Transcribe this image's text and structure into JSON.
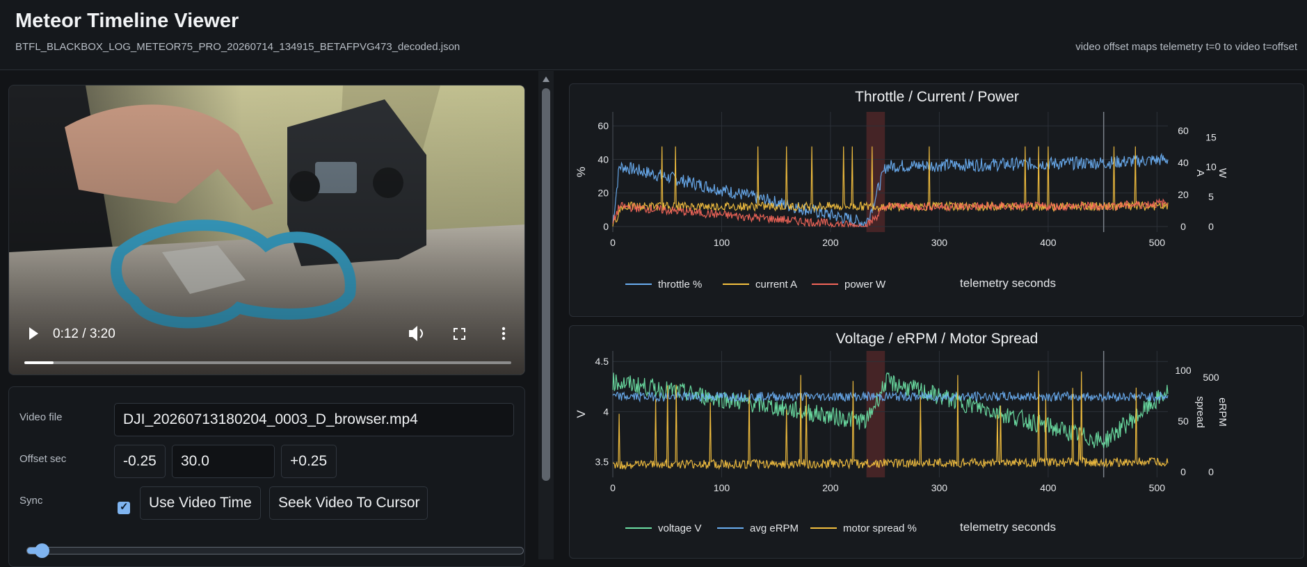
{
  "app": {
    "title": "Meteor Timeline Viewer",
    "file": "BTFL_BLACKBOX_LOG_METEOR75_PRO_20260714_134915_BETAFPVG473_decoded.json",
    "offset_note": "video offset maps telemetry t=0 to video t=offset"
  },
  "video": {
    "time": "0:12 / 3:20",
    "progress": 0.06,
    "controls": [
      "play-icon",
      "volume-icon",
      "fullscreen-icon",
      "more-vert-icon"
    ]
  },
  "controls": {
    "video_file_label": "Video file",
    "video_file_value": "DJI_20260713180204_0003_D_browser.mp4",
    "offset_label": "Offset sec",
    "minus_label": "-0.25",
    "offset_value": "30.0",
    "plus_label": "+0.25",
    "sync_label": "Sync",
    "sync_checked": true,
    "use_video_time_label": "Use Video Time",
    "seek_video_label": "Seek Video To Cursor",
    "timeline_position": 0.01
  },
  "colors": {
    "accent": "#7fb4f0",
    "throttle": "#6aaef2",
    "current": "#f5c13f",
    "power": "#f4665a",
    "voltage": "#6de0a4",
    "erpm": "#6aaef2",
    "spread": "#f5c13f",
    "highlight": "#5a2a2a"
  },
  "chart_data": [
    {
      "type": "line",
      "title": "Throttle / Current / Power",
      "xlabel": "telemetry seconds",
      "ylabel": "%",
      "xlim": [
        0,
        510
      ],
      "ylim": [
        0,
        65
      ],
      "x_ticks": [
        "0",
        "100",
        "200",
        "300",
        "400",
        "500"
      ],
      "y_ticks": [
        "0",
        "20",
        "40",
        "60"
      ],
      "y2_ticks": [
        "0",
        "20",
        "40",
        "60"
      ],
      "y3_ticks": [
        "0",
        "5",
        "10",
        "15"
      ],
      "y2_label": "A",
      "y3_label": "W",
      "highlight_range": [
        233,
        250
      ],
      "vlines": [
        451
      ],
      "legend": [
        "throttle %",
        "current A",
        "power W"
      ],
      "series": [
        {
          "name": "throttle %",
          "levels": [
            [
              0,
              2
            ],
            [
              6,
              36
            ],
            [
              233,
              2
            ],
            [
              251,
              36
            ],
            [
              451,
              38
            ],
            [
              510,
              40
            ]
          ]
        },
        {
          "name": "current A",
          "levels": [
            [
              0,
              0
            ],
            [
              8,
              12
            ],
            [
              510,
              12
            ]
          ]
        },
        {
          "name": "power W",
          "levels": [
            [
              0,
              2
            ],
            [
              6,
              12
            ],
            [
              233,
              0
            ],
            [
              251,
              12
            ],
            [
              451,
              12
            ],
            [
              510,
              14
            ]
          ]
        }
      ]
    },
    {
      "type": "line",
      "title": "Voltage / eRPM / Motor Spread",
      "xlabel": "telemetry seconds",
      "ylabel": "V",
      "xlim": [
        0,
        510
      ],
      "ylim": [
        3.4,
        4.55
      ],
      "x_ticks": [
        "0",
        "100",
        "200",
        "300",
        "400",
        "500"
      ],
      "y_ticks": [
        "3.5",
        "4",
        "4.5"
      ],
      "y2_ticks": [
        "0",
        "50",
        "100"
      ],
      "y3_ticks": [
        "0",
        "500"
      ],
      "y2_label": "spread",
      "y3_label": "eRPM",
      "highlight_range": [
        233,
        250
      ],
      "vlines": [
        451
      ],
      "legend": [
        "voltage V",
        "avg eRPM",
        "motor spread %"
      ],
      "series": [
        {
          "name": "voltage V",
          "levels": [
            [
              0,
              4.3
            ],
            [
              233,
              3.9
            ],
            [
              251,
              4.3
            ],
            [
              451,
              3.7
            ],
            [
              510,
              4.2
            ]
          ]
        },
        {
          "name": "avg eRPM",
          "levels": [
            [
              0,
              4.15
            ],
            [
              510,
              4.15
            ]
          ]
        },
        {
          "name": "motor spread %",
          "levels": [
            [
              0,
              3.47
            ],
            [
              510,
              3.5
            ]
          ]
        }
      ]
    }
  ]
}
